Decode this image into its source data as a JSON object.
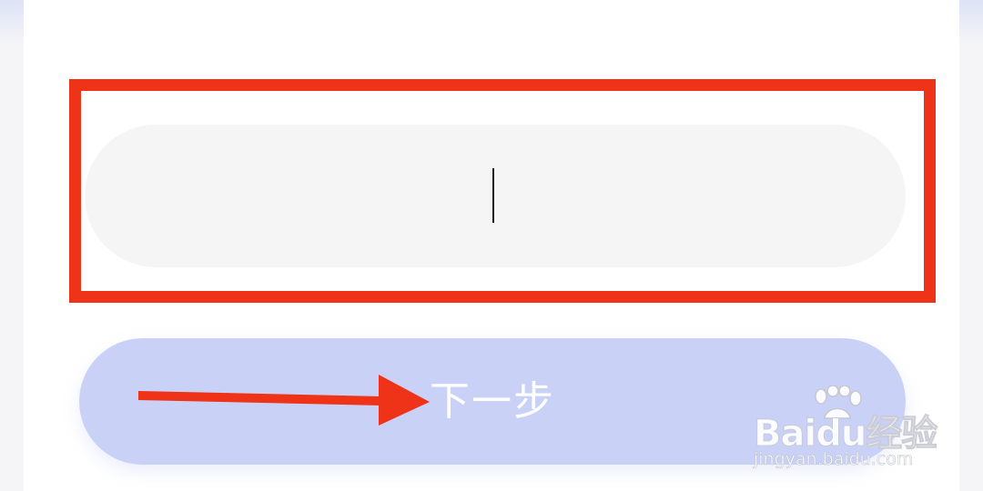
{
  "input": {
    "value": "",
    "placeholder": ""
  },
  "next_button": {
    "label": "下一步"
  },
  "watermark": {
    "logo_text": "Baidu经验",
    "url": "jingyan.baidu.com"
  },
  "colors": {
    "annotation_red": "#ee3318",
    "button_bg": "#c9d2f6",
    "input_bg": "#f5f5f5",
    "card_bg": "#ffffff"
  },
  "icons": {
    "arrow": "red-arrow-right-icon",
    "watermark_paw": "baidu-paw-icon"
  }
}
